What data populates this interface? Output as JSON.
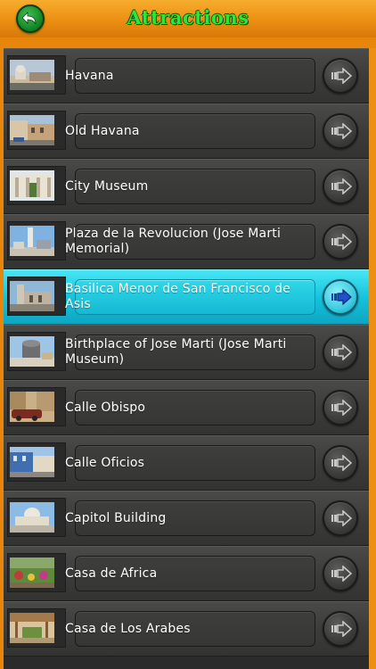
{
  "header": {
    "title": "Attractions",
    "back_icon": "back-arrow-icon",
    "accent_color": "#28e83a",
    "bar_color": "#ec8f12"
  },
  "list": {
    "selected_color": "#17c3dc",
    "items": [
      {
        "label": "Havana",
        "selected": false
      },
      {
        "label": "Old Havana",
        "selected": false
      },
      {
        "label": "City Museum",
        "selected": false
      },
      {
        "label": "Plaza de la Revolucion (Jose Marti Memorial)",
        "selected": false
      },
      {
        "label": "Basilica Menor de San Francisco de Asis",
        "selected": true
      },
      {
        "label": "Birthplace of Jose Marti (Jose Marti Museum)",
        "selected": false
      },
      {
        "label": "Calle Obispo",
        "selected": false
      },
      {
        "label": "Calle Oficios",
        "selected": false
      },
      {
        "label": "Capitol Building",
        "selected": false
      },
      {
        "label": "Casa de Africa",
        "selected": false
      },
      {
        "label": "Casa de Los Arabes",
        "selected": false
      }
    ]
  }
}
